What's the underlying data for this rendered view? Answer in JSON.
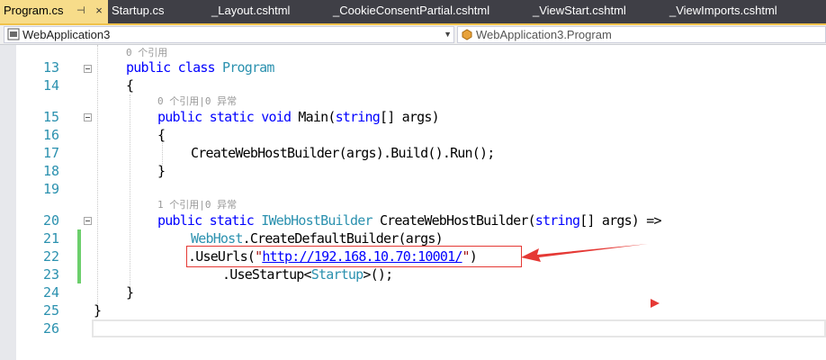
{
  "tabs": [
    {
      "label": "Program.cs",
      "active": true
    },
    {
      "label": "Startup.cs"
    },
    {
      "label": "_Layout.cshtml"
    },
    {
      "label": "_CookieConsentPartial.cshtml"
    },
    {
      "label": "_ViewStart.cshtml"
    },
    {
      "label": "_ViewImports.cshtml"
    }
  ],
  "tab_pin_icon": "pin-icon",
  "tab_close_icon": "close-icon",
  "nav": {
    "project": "WebApplication3",
    "type": "WebApplication3.Program"
  },
  "code": {
    "lens_class": "0 个引用",
    "lens_main": "0 个引用|0 异常",
    "lens_builder": "1 个引用|0 异常",
    "line_numbers": [
      "13",
      "14",
      "15",
      "16",
      "17",
      "18",
      "19",
      "20",
      "21",
      "22",
      "23",
      "24",
      "25",
      "26"
    ],
    "tokens": {
      "public": "public",
      "class": "class",
      "program": "Program",
      "static": "static",
      "void": "void",
      "main": "Main(",
      "string": "string",
      "args_close": "[] args)",
      "brace_open": "{",
      "brace_close": "}",
      "run_line": "CreateWebHostBuilder(args).Build().Run();",
      "iwebhostbuilder": "IWebHostBuilder",
      "builder_name": " CreateWebHostBuilder(",
      "builder_args": "[] args) =>",
      "webhost": "WebHost",
      "default_builder": ".CreateDefaultBuilder(args)",
      "useurls": ".UseUrls(",
      "quote": "\"",
      "url": "http://192.168.10.70:10001/",
      "paren_close": ")",
      "usestartup": ".UseStartup<",
      "startup": "Startup",
      "usestartup_end": ">();"
    }
  },
  "colors": {
    "keyword": "#0000ff",
    "type": "#2b91af",
    "string": "#a31515",
    "highlight_box": "#e53935"
  }
}
